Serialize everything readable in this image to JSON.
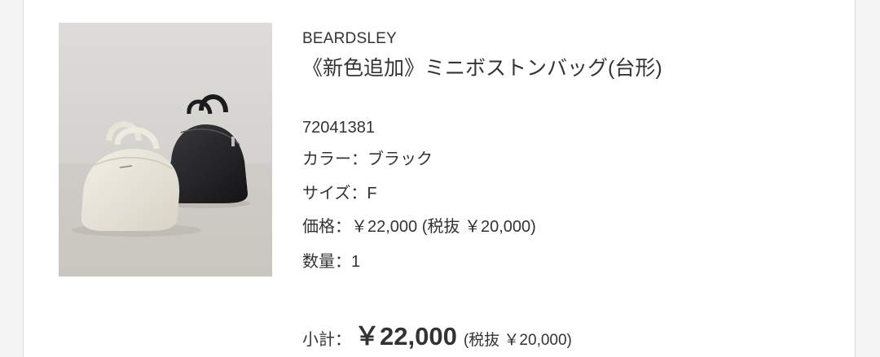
{
  "product": {
    "brand": "BEARDSLEY",
    "name": "《新色追加》ミニボストンバッグ(台形)",
    "sku": "72041381",
    "color_line": "カラー：ブラック",
    "size_line": "サイズ：F",
    "price_line": "価格：￥22,000 (税抜 ￥20,000)",
    "quantity_line": "数量：1",
    "image_icon": "handbag-photo"
  },
  "subtotal": {
    "label": "小計：",
    "amount": "￥22,000",
    "tax_note": "(税抜 ￥20,000)"
  }
}
